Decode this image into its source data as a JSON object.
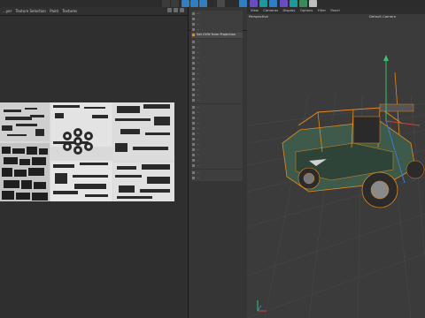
{
  "uv_editor": {
    "menu": [
      "...yer",
      "Texture Selection",
      "Paint",
      "Textures"
    ]
  },
  "middle_panel": {
    "selected_item": "Set UVW from Projection",
    "items": [
      "...",
      "...",
      "...",
      "...",
      "...",
      "...",
      "...",
      "...",
      "...",
      "...",
      "...",
      "...",
      "...",
      "...",
      "...",
      "...",
      "...",
      "...",
      "...",
      "...",
      "...",
      "...",
      "...",
      "...",
      "...",
      "...",
      "...",
      "...",
      "...",
      "..."
    ]
  },
  "viewport": {
    "menu": [
      "View",
      "Cameras",
      "Display",
      "Options",
      "Filter",
      "Panel"
    ],
    "view_name": "Perspective",
    "camera_name": "Default Camera"
  },
  "colors": {
    "toolbar_blue": "#2f7fc2",
    "toolbar_teal": "#1a9a9a",
    "toolbar_purple": "#6a4bc2",
    "selection_orange": "#e58a1f",
    "vehicle_green": "#3e5a4a",
    "axis_green": "#39c36a",
    "axis_red": "#d2443a",
    "axis_blue": "#3b7ad8"
  }
}
